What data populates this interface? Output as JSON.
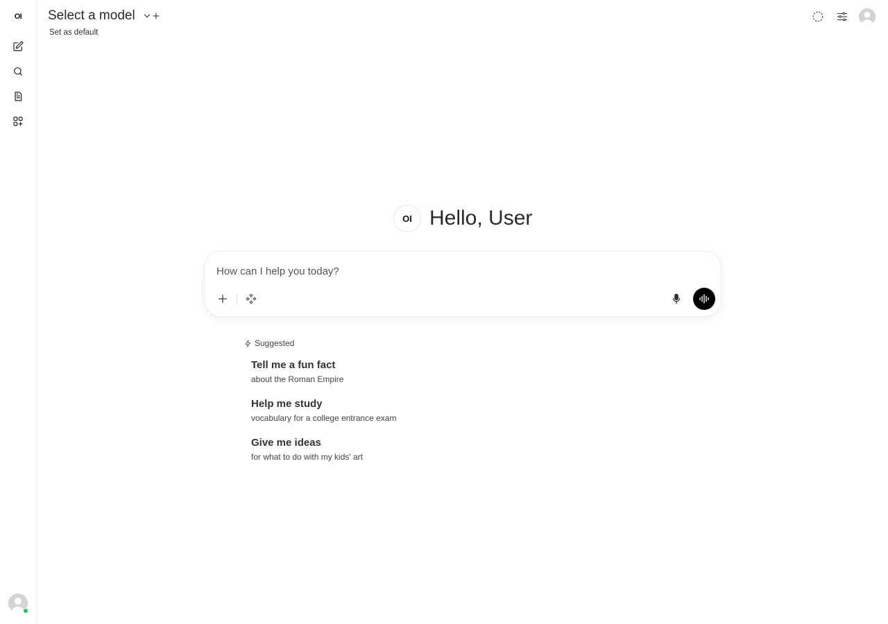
{
  "rail": {
    "logo_text": "OI",
    "items": [
      {
        "name": "new-chat",
        "icon": "pencil-square-icon"
      },
      {
        "name": "search",
        "icon": "search-icon"
      },
      {
        "name": "notes",
        "icon": "document-icon"
      },
      {
        "name": "workspace",
        "icon": "apps-plus-icon"
      }
    ],
    "user_status_color": "#22c55e"
  },
  "header": {
    "model_title": "Select a model",
    "set_default": "Set as default"
  },
  "greeting": {
    "logo_text": "OI",
    "text": "Hello, User"
  },
  "chat_input": {
    "placeholder": "How can I help you today?",
    "value": ""
  },
  "suggestions": {
    "label": "Suggested",
    "items": [
      {
        "title": "Tell me a fun fact",
        "subtitle": "about the Roman Empire"
      },
      {
        "title": "Help me study",
        "subtitle": "vocabulary for a college entrance exam"
      },
      {
        "title": "Give me ideas",
        "subtitle": "for what to do with my kids' art"
      }
    ]
  }
}
